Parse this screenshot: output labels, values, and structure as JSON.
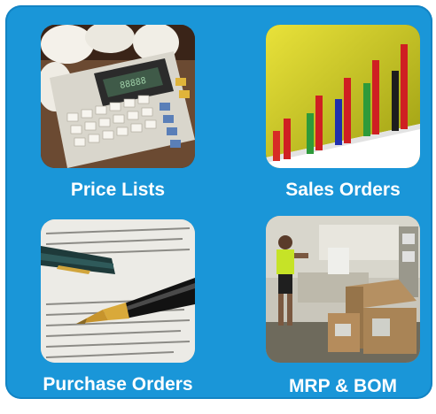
{
  "tiles": [
    {
      "label": "Price Lists",
      "image": "calculator-photo"
    },
    {
      "label": "Sales Orders",
      "image": "bar-chart-photo"
    },
    {
      "label": "Purchase Orders",
      "image": "pen-document-photo"
    },
    {
      "label": "MRP & BOM",
      "image": "warehouse-photo"
    }
  ],
  "colors": {
    "panel_background": "#1a96d8",
    "label_text": "#ffffff"
  }
}
